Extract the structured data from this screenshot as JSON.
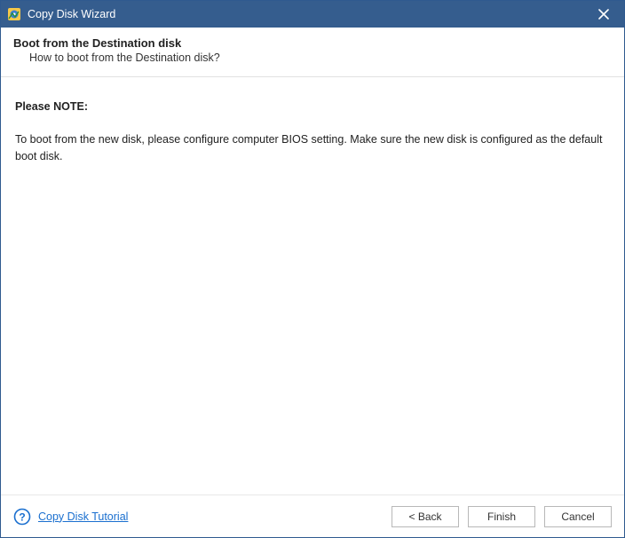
{
  "titlebar": {
    "title": "Copy Disk Wizard"
  },
  "header": {
    "title": "Boot from the Destination disk",
    "subtitle": "How to boot from the Destination disk?"
  },
  "content": {
    "note_label": "Please NOTE:",
    "note_body": "To boot from the new disk, please configure computer BIOS setting. Make sure the new disk is configured as the default boot disk."
  },
  "footer": {
    "tutorial_link": "Copy Disk Tutorial",
    "back_label": "< Back",
    "finish_label": "Finish",
    "cancel_label": "Cancel"
  }
}
